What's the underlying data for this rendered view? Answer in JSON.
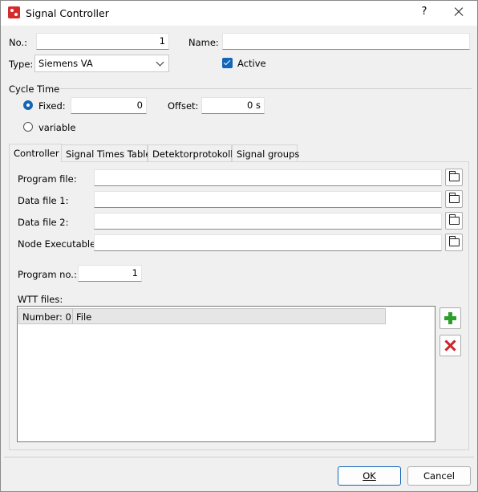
{
  "window": {
    "title": "Signal Controller",
    "help": "?"
  },
  "general": {
    "no_label": "No.:",
    "no_value": "1",
    "name_label": "Name:",
    "name_value": "",
    "type_label": "Type:",
    "type_value": "Siemens VA",
    "active_label": "Active",
    "active_checked": true
  },
  "cycle": {
    "group_label": "Cycle Time",
    "fixed_label": "Fixed:",
    "fixed_value": "0",
    "fixed_selected": true,
    "offset_label": "Offset:",
    "offset_value": "0 s",
    "variable_label": "variable"
  },
  "tabs": [
    "Controller",
    "Signal Times Table",
    "Detektorprotokoll",
    "Signal groups"
  ],
  "controller": {
    "files": [
      {
        "label": "Program file:",
        "value": ""
      },
      {
        "label": "Data file 1:",
        "value": ""
      },
      {
        "label": "Data file 2:",
        "value": ""
      },
      {
        "label": "Node Executable",
        "value": ""
      }
    ],
    "program_no_label": "Program no.:",
    "program_no_value": "1",
    "wtt_label": "WTT files:",
    "wtt_columns": [
      "Number: 0",
      "File"
    ],
    "wtt_rows": []
  },
  "buttons": {
    "ok": "OK",
    "cancel": "Cancel"
  },
  "colors": {
    "accent": "#1465b8",
    "add": "#2c9e2c",
    "delete": "#c8262d",
    "app_icon": "#d52b2b"
  },
  "icons": [
    "app-icon",
    "close-icon",
    "chevron-down-icon",
    "folder-open-icon",
    "add-icon",
    "delete-icon"
  ]
}
